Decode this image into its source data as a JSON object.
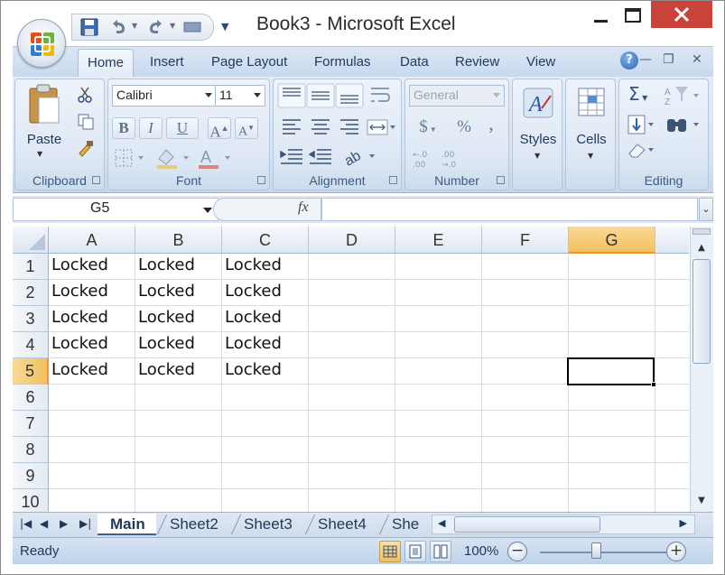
{
  "window": {
    "title": "Book3 - Microsoft Excel"
  },
  "ribbon": {
    "tabs": [
      "Home",
      "Insert",
      "Page Layout",
      "Formulas",
      "Data",
      "Review",
      "View"
    ],
    "active_tab": "Home",
    "clipboard": {
      "paste_label": "Paste",
      "group_label": "Clipboard"
    },
    "font": {
      "font_name": "Calibri",
      "font_size": "11",
      "bold": "B",
      "italic": "I",
      "underline": "U",
      "group_label": "Font"
    },
    "alignment": {
      "group_label": "Alignment"
    },
    "number": {
      "format": "General",
      "currency": "$",
      "percent": "%",
      "comma": ",",
      "group_label": "Number"
    },
    "styles": {
      "label": "Styles"
    },
    "cells": {
      "label": "Cells"
    },
    "editing": {
      "group_label": "Editing"
    }
  },
  "formula_bar": {
    "name_box": "G5",
    "fx_label": "fx",
    "formula": ""
  },
  "sheet": {
    "columns": [
      "A",
      "B",
      "C",
      "D",
      "E",
      "F",
      "G"
    ],
    "selected_column": "G",
    "rows": [
      {
        "num": "1",
        "cells": [
          "Locked",
          "Locked",
          "Locked",
          "",
          "",
          "",
          ""
        ]
      },
      {
        "num": "2",
        "cells": [
          "Locked",
          "Locked",
          "Locked",
          "",
          "",
          "",
          ""
        ]
      },
      {
        "num": "3",
        "cells": [
          "Locked",
          "Locked",
          "Locked",
          "",
          "",
          "",
          ""
        ]
      },
      {
        "num": "4",
        "cells": [
          "Locked",
          "Locked",
          "Locked",
          "",
          "",
          "",
          ""
        ]
      },
      {
        "num": "5",
        "cells": [
          "Locked",
          "Locked",
          "Locked",
          "",
          "",
          "",
          ""
        ]
      },
      {
        "num": "6",
        "cells": [
          "",
          "",
          "",
          "",
          "",
          "",
          ""
        ]
      },
      {
        "num": "7",
        "cells": [
          "",
          "",
          "",
          "",
          "",
          "",
          ""
        ]
      },
      {
        "num": "8",
        "cells": [
          "",
          "",
          "",
          "",
          "",
          "",
          ""
        ]
      },
      {
        "num": "9",
        "cells": [
          "",
          "",
          "",
          "",
          "",
          "",
          ""
        ]
      },
      {
        "num": "10",
        "cells": [
          "",
          "",
          "",
          "",
          "",
          "",
          ""
        ]
      }
    ],
    "selected_row": "5",
    "active_cell": "G5"
  },
  "sheet_tabs": {
    "tabs": [
      "Main",
      "Sheet2",
      "Sheet3",
      "Sheet4",
      "She"
    ],
    "active": "Main"
  },
  "status_bar": {
    "status": "Ready",
    "zoom": "100%"
  }
}
